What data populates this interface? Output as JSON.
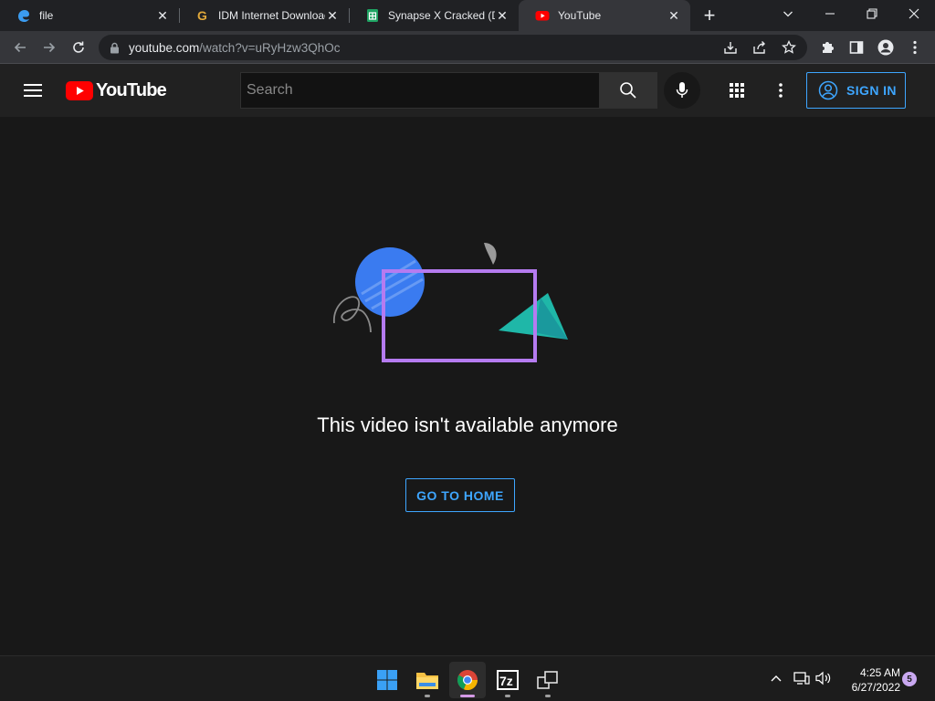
{
  "browser": {
    "tabs": [
      {
        "label": "file",
        "icon": "edge-file-icon",
        "active": false
      },
      {
        "label": "IDM Internet Download Manager",
        "icon": "g-favicon-icon",
        "active": false
      },
      {
        "label": "Synapse X Cracked (DC",
        "icon": "sheet-favicon-icon",
        "active": false
      },
      {
        "label": "YouTube",
        "icon": "youtube-favicon-icon",
        "active": true
      }
    ],
    "close_glyph": "✕",
    "new_tab_glyph": "+",
    "url_host": "youtube.com",
    "url_path": "/watch?v=uRyHzw3QhOc"
  },
  "youtube": {
    "logo_text": "YouTube",
    "search_placeholder": "Search",
    "signin_label": "SIGN IN",
    "message": "This video isn't available anymore",
    "go_home_label": "GO TO HOME",
    "colors": {
      "accent": "#3ea6ff",
      "brand_red": "#ff0000",
      "frame_purple": "#b57bf0",
      "circle_blue": "#3a7bf0",
      "triangle_teal": "#1fb7a8"
    }
  },
  "taskbar": {
    "apps": [
      "windows-start-icon",
      "file-explorer-icon",
      "chrome-icon",
      "7zip-icon",
      "app-window-icon"
    ],
    "time": "4:25 AM",
    "date": "6/27/2022",
    "notification_count": "5"
  }
}
